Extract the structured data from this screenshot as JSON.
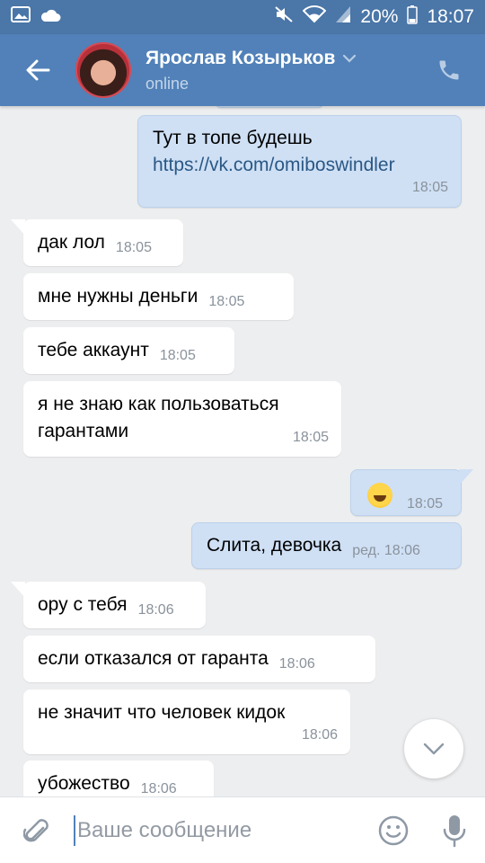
{
  "status_bar": {
    "battery": "20%",
    "time": "18:07",
    "icons": [
      "gallery-icon",
      "cloud-icon",
      "mute-icon",
      "wifi-icon",
      "signal-icon",
      "battery-icon"
    ]
  },
  "header": {
    "name": "Ярослав Козырьков",
    "status": "online",
    "colors": {
      "bar": "#5181b8",
      "status_bar": "#4a76a8"
    }
  },
  "messages": [
    {
      "dir": "out",
      "text": "Тут в топе будешь",
      "link": "https://vk.com/omiboswindler",
      "time": "18:05"
    },
    {
      "dir": "in",
      "text": "дак лол",
      "time": "18:05"
    },
    {
      "dir": "in",
      "text": "мне нужны деньги",
      "time": "18:05"
    },
    {
      "dir": "in",
      "text": "тебе аккаунт",
      "time": "18:05"
    },
    {
      "dir": "in",
      "text": "я не знаю как пользоваться\nгарантами",
      "time": "18:05"
    },
    {
      "dir": "out",
      "emoji": "rolling-on-floor-laughing-emoji",
      "time": "18:05"
    },
    {
      "dir": "out",
      "text": "Слита, девочка",
      "time": "ред. 18:06"
    },
    {
      "dir": "in",
      "text": "ору с тебя",
      "time": "18:06"
    },
    {
      "dir": "in",
      "text": "если отказался от гаранта",
      "time": "18:06"
    },
    {
      "dir": "in",
      "text": "не значит что человек кидок",
      "time": "18:06"
    },
    {
      "dir": "in",
      "text": "убожество",
      "time": "18:06"
    }
  ],
  "composer": {
    "placeholder": "Ваше сообщение"
  },
  "colors": {
    "chat_bg": "#edeef0",
    "outgoing_bubble": "#cfe0f5",
    "incoming_bubble": "#ffffff",
    "link": "#2a5885"
  }
}
